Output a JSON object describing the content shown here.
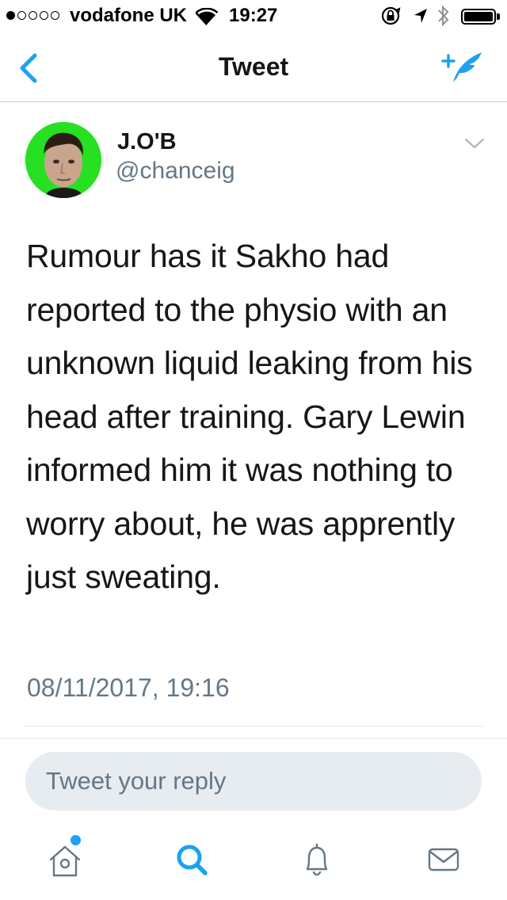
{
  "status_bar": {
    "carrier": "vodafone UK",
    "time": "19:27",
    "signal_bars_filled": 1,
    "signal_bars_total": 5,
    "battery_level": 1.0
  },
  "nav": {
    "title": "Tweet",
    "back_icon": "chevron-left-icon",
    "compose_icon": "compose-tweet-icon"
  },
  "tweet": {
    "display_name": "J.O'B",
    "handle": "@chanceig",
    "text": "Rumour has it Sakho had reported to the physio with an unknown liquid leaking from his head after training. Gary Lewin informed him it was nothing to worry about, he was apprently just sweating.",
    "timestamp": "08/11/2017, 19:16"
  },
  "reply": {
    "placeholder": "Tweet your reply"
  },
  "tab_bar": {
    "items": [
      {
        "icon": "home-icon",
        "has_badge": true
      },
      {
        "icon": "search-icon",
        "active": true
      },
      {
        "icon": "bell-icon"
      },
      {
        "icon": "mail-icon"
      }
    ]
  },
  "colors": {
    "accent": "#1da1f2",
    "text_primary": "#14171a",
    "text_secondary": "#657786",
    "avatar_background": "#27e021",
    "reply_box": "#e6ecf0"
  }
}
